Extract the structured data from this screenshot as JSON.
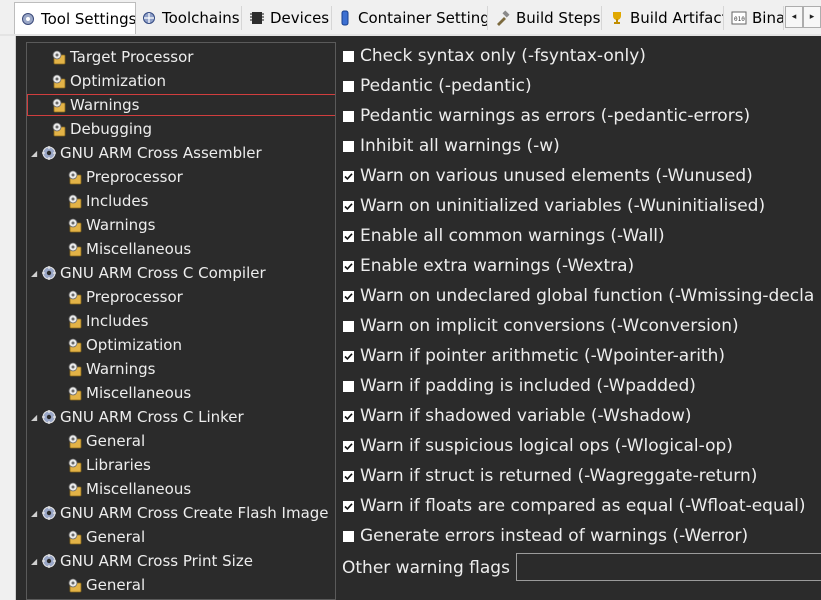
{
  "tabs": [
    {
      "label": "Tool Settings",
      "icon": "tool-settings-icon",
      "active": true
    },
    {
      "label": "Toolchains",
      "icon": "toolchains-icon",
      "active": false
    },
    {
      "label": "Devices",
      "icon": "devices-icon",
      "active": false
    },
    {
      "label": "Container Settings",
      "icon": "container-icon",
      "active": false
    },
    {
      "label": "Build Steps",
      "icon": "build-steps-icon",
      "active": false
    },
    {
      "label": "Build Artifact",
      "icon": "trophy-icon",
      "active": false
    },
    {
      "label": "Bina",
      "icon": "binary-icon",
      "active": false
    }
  ],
  "scroll_buttons": {
    "left": "◂",
    "right": "▸"
  },
  "tree": [
    {
      "label": "Target Processor",
      "level": 1,
      "type": "settings",
      "expandable": false
    },
    {
      "label": "Optimization",
      "level": 1,
      "type": "settings",
      "expandable": false
    },
    {
      "label": "Warnings",
      "level": 1,
      "type": "settings",
      "expandable": false,
      "selected": true
    },
    {
      "label": "Debugging",
      "level": 1,
      "type": "settings",
      "expandable": false
    },
    {
      "label": "GNU ARM Cross Assembler",
      "level": 1,
      "type": "tool",
      "expandable": true
    },
    {
      "label": "Preprocessor",
      "level": 2,
      "type": "settings",
      "expandable": false
    },
    {
      "label": "Includes",
      "level": 2,
      "type": "settings",
      "expandable": false
    },
    {
      "label": "Warnings",
      "level": 2,
      "type": "settings",
      "expandable": false
    },
    {
      "label": "Miscellaneous",
      "level": 2,
      "type": "settings",
      "expandable": false
    },
    {
      "label": "GNU ARM Cross C Compiler",
      "level": 1,
      "type": "tool",
      "expandable": true
    },
    {
      "label": "Preprocessor",
      "level": 2,
      "type": "settings",
      "expandable": false
    },
    {
      "label": "Includes",
      "level": 2,
      "type": "settings",
      "expandable": false
    },
    {
      "label": "Optimization",
      "level": 2,
      "type": "settings",
      "expandable": false
    },
    {
      "label": "Warnings",
      "level": 2,
      "type": "settings",
      "expandable": false
    },
    {
      "label": "Miscellaneous",
      "level": 2,
      "type": "settings",
      "expandable": false
    },
    {
      "label": "GNU ARM Cross C Linker",
      "level": 1,
      "type": "tool",
      "expandable": true
    },
    {
      "label": "General",
      "level": 2,
      "type": "settings",
      "expandable": false
    },
    {
      "label": "Libraries",
      "level": 2,
      "type": "settings",
      "expandable": false
    },
    {
      "label": "Miscellaneous",
      "level": 2,
      "type": "settings",
      "expandable": false
    },
    {
      "label": "GNU ARM Cross Create Flash Image",
      "level": 1,
      "type": "tool",
      "expandable": true
    },
    {
      "label": "General",
      "level": 2,
      "type": "settings",
      "expandable": false
    },
    {
      "label": "GNU ARM Cross Print Size",
      "level": 1,
      "type": "tool",
      "expandable": true
    },
    {
      "label": "General",
      "level": 2,
      "type": "settings",
      "expandable": false
    }
  ],
  "options": [
    {
      "label": "Check syntax only (-fsyntax-only)",
      "checked": false
    },
    {
      "label": "Pedantic (-pedantic)",
      "checked": false
    },
    {
      "label": "Pedantic warnings as errors (-pedantic-errors)",
      "checked": false
    },
    {
      "label": "Inhibit all warnings (-w)",
      "checked": false
    },
    {
      "label": "Warn on various unused elements (-Wunused)",
      "checked": true
    },
    {
      "label": "Warn on uninitialized variables (-Wuninitialised)",
      "checked": true
    },
    {
      "label": "Enable all common warnings (-Wall)",
      "checked": true
    },
    {
      "label": "Enable extra warnings (-Wextra)",
      "checked": true
    },
    {
      "label": "Warn on undeclared global function (-Wmissing-decla",
      "checked": true
    },
    {
      "label": "Warn on implicit conversions (-Wconversion)",
      "checked": false
    },
    {
      "label": "Warn if pointer arithmetic (-Wpointer-arith)",
      "checked": true
    },
    {
      "label": "Warn if padding is included (-Wpadded)",
      "checked": false
    },
    {
      "label": "Warn if shadowed variable (-Wshadow)",
      "checked": true
    },
    {
      "label": "Warn if suspicious logical ops (-Wlogical-op)",
      "checked": true
    },
    {
      "label": "Warn if struct is returned (-Wagreggate-return)",
      "checked": true
    },
    {
      "label": "Warn if floats are compared as equal (-Wfloat-equal)",
      "checked": true
    },
    {
      "label": "Generate errors instead of warnings (-Werror)",
      "checked": false
    }
  ],
  "other_flags": {
    "label": "Other warning flags",
    "value": ""
  },
  "colors": {
    "panel_bg": "#2b2b2b",
    "text": "#ededed",
    "tab_bg": "#f0f0f0",
    "selection_outline": "#d13e3e",
    "settings_icon": "#e3b347",
    "tool_icon": "#9aa7c7"
  }
}
